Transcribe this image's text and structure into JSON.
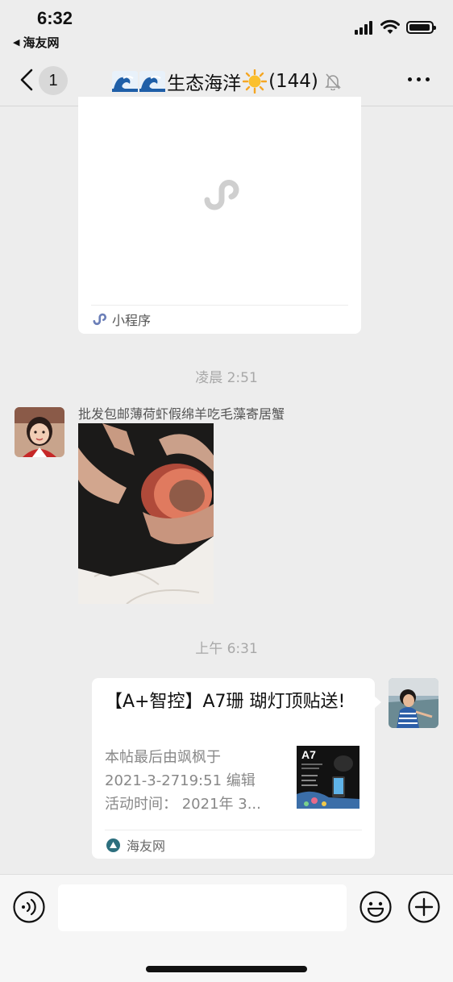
{
  "status_bar": {
    "time": "6:32",
    "back_app": "海友网"
  },
  "nav": {
    "unread_count": "1",
    "title": "生态海洋",
    "member_count": "(144)"
  },
  "messages": {
    "mini_program": {
      "footer_label": "小程序"
    },
    "timestamp_1": "凌晨 2:51",
    "photo_message": {
      "sender": "批发包邮薄荷虾假绵羊吃毛藻寄居蟹"
    },
    "timestamp_2": "上午 6:31",
    "link_card": {
      "title": "【A+智控】A7珊 瑚灯顶贴送!",
      "desc_line1": "本帖最后由飒枫于",
      "desc_line2": "2021-3-2719:51 编辑",
      "desc_line3": "活动时间：  2021年 3...",
      "thumb_title": "A7",
      "source": "海友网"
    }
  },
  "input_bar": {
    "placeholder": ""
  },
  "colors": {
    "background": "#ededed",
    "bubble": "#ffffff",
    "muted_text": "#a8a8a8"
  }
}
